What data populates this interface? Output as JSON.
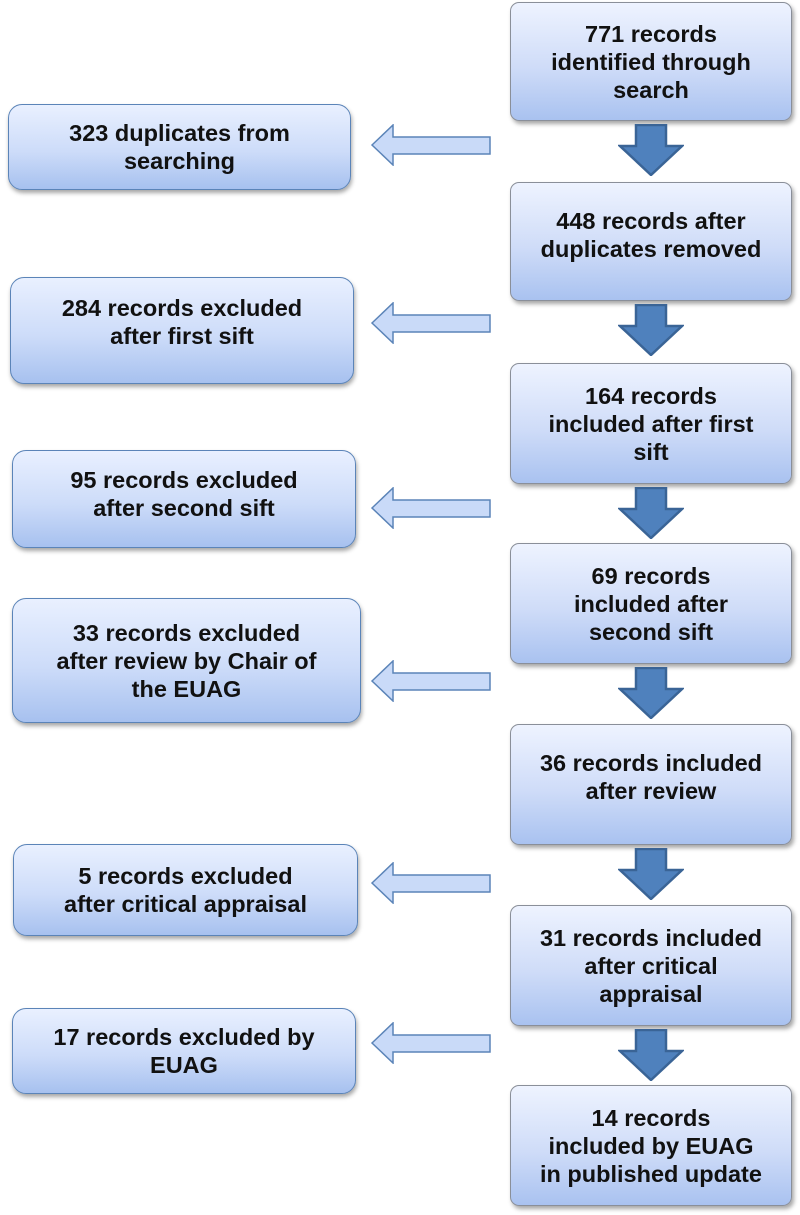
{
  "diagram": {
    "type": "flowchart",
    "main_flow": [
      {
        "id": "identified",
        "lines": [
          "771 records",
          "identified through",
          "search"
        ]
      },
      {
        "id": "after-duplicates",
        "lines": [
          "448 records after",
          "duplicates removed"
        ]
      },
      {
        "id": "after-first-sift",
        "lines": [
          "164 records",
          "included after first",
          "sift"
        ]
      },
      {
        "id": "after-second-sift",
        "lines": [
          "69 records",
          "included after",
          "second sift"
        ]
      },
      {
        "id": "after-review",
        "lines": [
          "36 records included",
          "after review"
        ]
      },
      {
        "id": "after-appraisal",
        "lines": [
          "31 records included",
          "after critical",
          "appraisal"
        ]
      },
      {
        "id": "published",
        "lines": [
          "14 records",
          "included by EUAG",
          "in published update"
        ]
      }
    ],
    "exclusions": [
      {
        "id": "duplicates",
        "lines": [
          "323 duplicates from",
          "searching"
        ]
      },
      {
        "id": "first-sift",
        "lines": [
          "284 records excluded",
          "after first sift"
        ]
      },
      {
        "id": "second-sift",
        "lines": [
          "95 records excluded",
          "after second sift"
        ]
      },
      {
        "id": "chair-review",
        "lines": [
          "33 records excluded",
          "after review by Chair of",
          "the EUAG"
        ]
      },
      {
        "id": "critical-appraisal",
        "lines": [
          "5 records excluded",
          "after critical appraisal"
        ]
      },
      {
        "id": "euag",
        "lines": [
          "17 records excluded by",
          "EUAG"
        ]
      }
    ],
    "colors": {
      "down_arrow_fill": "#4f81bd",
      "down_arrow_stroke": "#3a6496",
      "side_arrow_fill": "#c9daf8",
      "side_arrow_stroke": "#5b84b8"
    }
  }
}
